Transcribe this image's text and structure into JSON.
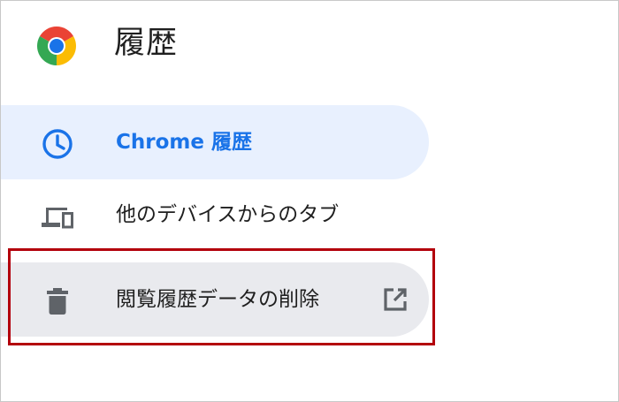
{
  "header": {
    "logo_icon": "chrome-logo-icon",
    "title": "履歴"
  },
  "sidebar": {
    "items": [
      {
        "label": "Chrome 履歴",
        "icon": "clock-icon",
        "state": "selected"
      },
      {
        "label": "他のデバイスからのタブ",
        "icon": "devices-icon",
        "state": "default"
      },
      {
        "label": "閲覧履歴データの削除",
        "icon": "trash-icon",
        "trailing_icon": "open-in-new-icon",
        "state": "hovered"
      }
    ]
  },
  "colors": {
    "accent": "#1a73e8",
    "selected_bg": "#e8f0fe",
    "hover_bg": "#e9eaee",
    "highlight_border": "#b3000c",
    "icon_gray": "#5f6368"
  }
}
